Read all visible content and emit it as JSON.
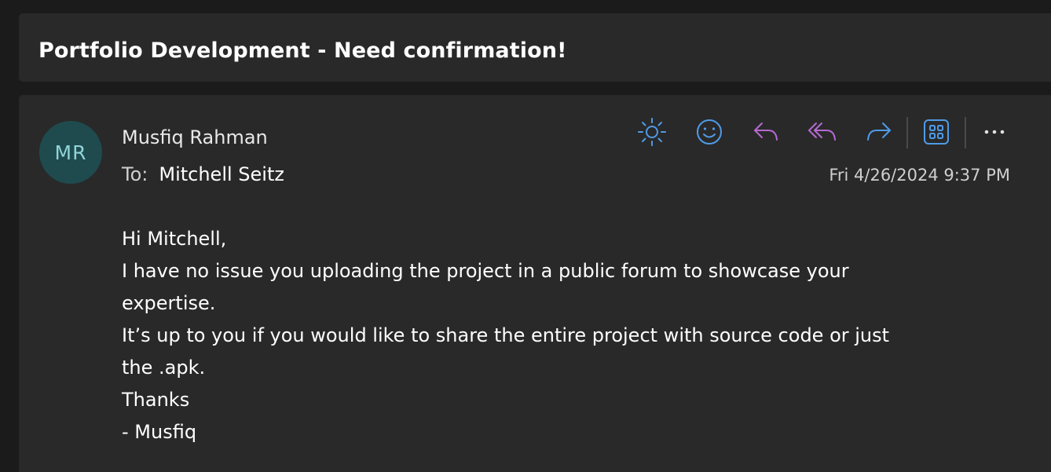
{
  "subject": {
    "title": "Portfolio Development - Need confirmation!"
  },
  "message": {
    "avatar_initials": "MR",
    "sender_name": "Musfiq Rahman",
    "to_label": "To:",
    "recipient": "Mitchell Seitz",
    "timestamp": "Fri 4/26/2024 9:37 PM",
    "body_lines": [
      "Hi Mitchell,",
      "I have no issue you uploading the project in a public forum to showcase your",
      "expertise.",
      "It’s up to you if you would like to share the entire project with source code or just",
      "the .apk.",
      "Thanks",
      "- Musfiq"
    ]
  },
  "toolbar": {
    "items": [
      {
        "icon": "sun-icon",
        "color": "#4f9be8"
      },
      {
        "icon": "emoji-icon",
        "color": "#4f9be8"
      },
      {
        "icon": "reply-icon",
        "color": "#b56ad1"
      },
      {
        "icon": "reply-all-icon",
        "color": "#b56ad1"
      },
      {
        "icon": "forward-icon",
        "color": "#4f9be8"
      },
      {
        "icon": "apps-icon",
        "color": "#4f9be8"
      },
      {
        "icon": "more-icon",
        "color": "#e0e0e0"
      }
    ]
  },
  "colors": {
    "background": "#1b1b1b",
    "card": "#292929",
    "avatar_bg": "#1f4b4f",
    "avatar_text": "#8fd3d8",
    "accent_blue": "#4f9be8",
    "accent_purple": "#b56ad1"
  }
}
